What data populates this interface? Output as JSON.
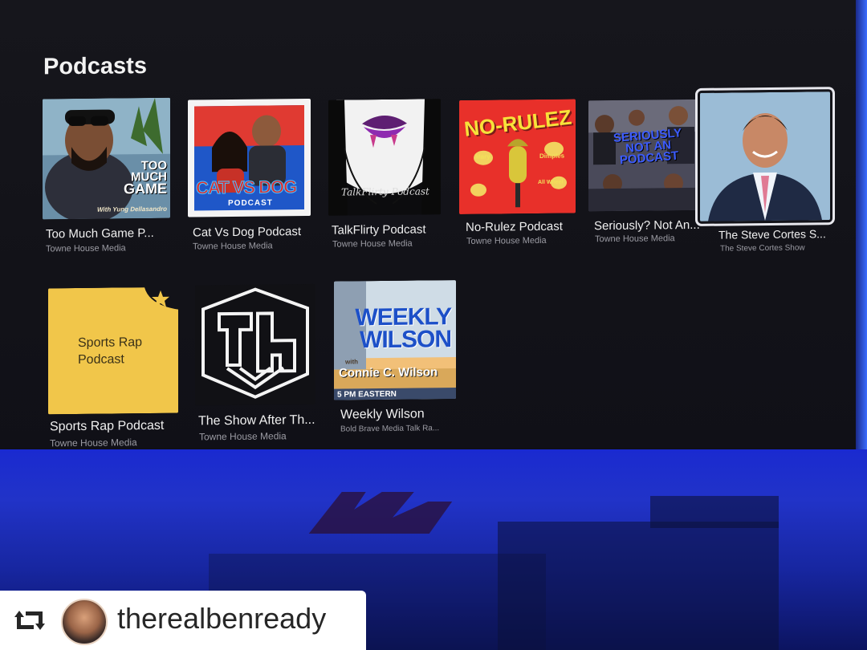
{
  "section": {
    "title": "Podcasts"
  },
  "podcasts": [
    {
      "title": "Too Much Game P...",
      "publisher": "Towne House Media",
      "art_text": [
        "TOO",
        "MUCH",
        "GAME"
      ],
      "art_sub": "With Yung Dellasandro"
    },
    {
      "title": "Cat Vs Dog Podcast",
      "publisher": "Towne House Media",
      "art_text": [
        "CAT VS DOG",
        "PODCAST"
      ]
    },
    {
      "title": "TalkFlirty Podcast",
      "publisher": "Towne House Media",
      "art_text": [
        "TalkFlirty Podcast"
      ]
    },
    {
      "title": "No-Rulez Podcast",
      "publisher": "Towne House Media",
      "art_text": [
        "NO-RULEZ",
        "Mary",
        "Dimples",
        "All Wheel"
      ]
    },
    {
      "title": "Seriously? Not An...",
      "publisher": "Towne House Media",
      "art_text": [
        "SERIOUSLY",
        "NOT AN",
        "PODCAST"
      ]
    },
    {
      "title": "The Steve Cortes S...",
      "publisher": "The Steve Cortes Show",
      "selected": true
    },
    {
      "title": "Sports Rap Podcast",
      "publisher": "Towne House Media",
      "art_text": [
        "Sports Rap",
        "Podcast"
      ]
    },
    {
      "title": "The Show After Th...",
      "publisher": "Towne House Media"
    },
    {
      "title": "Weekly Wilson",
      "publisher": "Bold Brave Media Talk Ra...",
      "art_text": [
        "WEEKLY",
        "WILSON",
        "with",
        "Connie C. Wilson",
        "5 PM EASTERN"
      ]
    }
  ],
  "repost": {
    "username": "therealbenready",
    "icon": "repost-icon"
  },
  "colors": {
    "wall": "#2133c8",
    "screen": "#141419",
    "accent_yellow": "#f1c64a",
    "nr_red": "#e8302a"
  }
}
